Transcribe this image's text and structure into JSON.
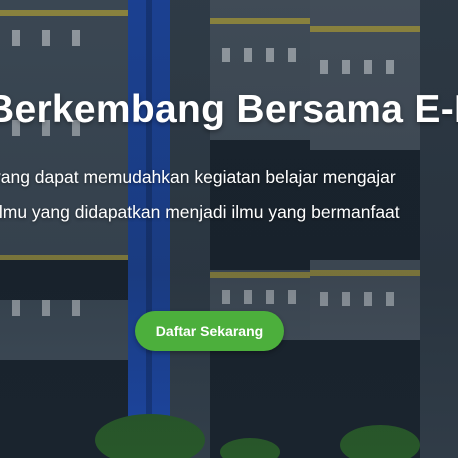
{
  "hero": {
    "title": "Berkembang Bersama E-Learning",
    "description_line1": "yang dapat memudahkan kegiatan belajar mengajar",
    "description_line2": "Ilmu yang didapatkan menjadi ilmu yang bermanfaat",
    "cta_label": "Daftar Sekarang"
  },
  "colors": {
    "cta_background": "#4caf3c",
    "text": "#ffffff",
    "building_blue_pillar": "#1f53c9",
    "building_wall": "#4b5a68"
  },
  "icons": [
    "school-building-background"
  ]
}
